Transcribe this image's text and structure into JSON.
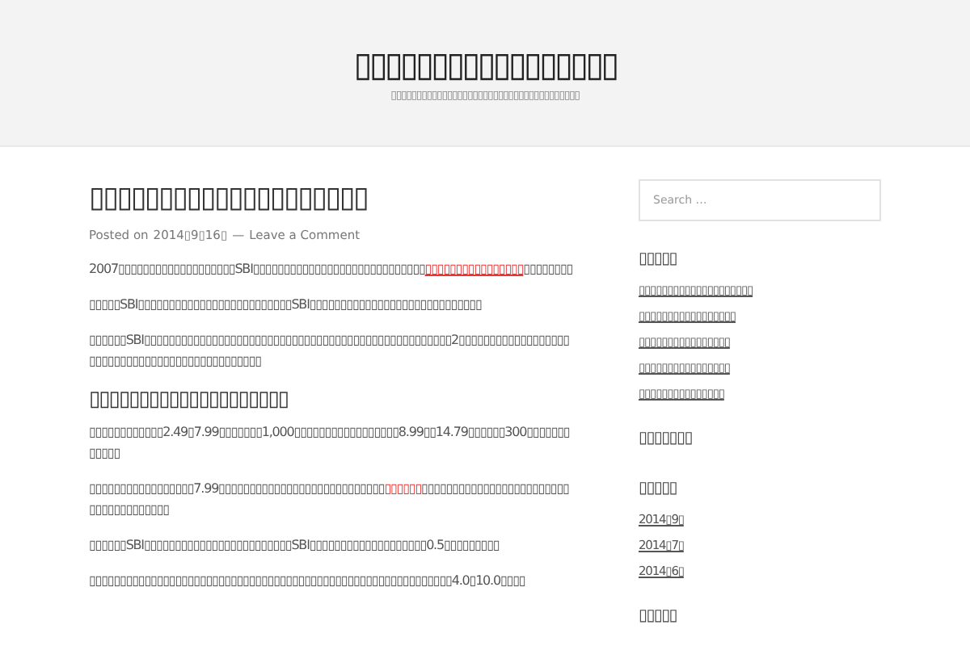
{
  "header": {
    "site_title": "▯▯▯▯▯▯▯▯▯▯▯▯▯▯▯▯▯",
    "tagline": "▯▯▯▯▯▯▯▯▯▯▯▯▯▯▯▯▯▯▯▯▯▯▯▯▯▯▯▯▯▯▯▯▯▯▯▯▯"
  },
  "post": {
    "title": "▯▯▯▯▯▯▯▯▯▯▯▯▯▯▯▯▯▯▯▯",
    "meta_prefix": "Posted on",
    "date": "2014▯9▯16▯",
    "meta_separator": "—",
    "comment_link": "Leave a Comment",
    "blocks": [
      {
        "kind": "paragraph",
        "segments": [
          {
            "kind": "text",
            "text": "2007▯▯▯▯▯▯▯▯▯▯▯▯▯▯▯▯▯▯▯SBI▯▯▯▯▯▯▯▯▯▯▯▯▯▯▯▯▯▯▯▯▯▯▯▯▯▯▯▯"
          },
          {
            "kind": "link",
            "text": "▯▯▯▯▯▯▯▯▯▯▯▯▯▯▯▯"
          },
          {
            "kind": "text",
            "text": "▯▯▯▯▯▯▯▯"
          }
        ]
      },
      {
        "kind": "paragraph",
        "segments": [
          {
            "kind": "text",
            "text": "▯▯▯▯▯SBI▯▯▯▯▯▯▯▯▯▯▯▯▯▯▯▯▯▯▯▯▯▯▯▯▯SBI▯▯▯▯▯▯▯▯▯▯▯▯▯▯▯▯▯▯▯▯▯▯▯▯▯▯▯▯"
          }
        ]
      },
      {
        "kind": "paragraph",
        "segments": [
          {
            "kind": "text",
            "text": "▯▯▯▯▯▯SBI▯▯▯▯▯▯▯▯▯▯▯▯▯▯▯▯▯▯▯▯▯▯▯▯▯▯▯▯▯▯▯▯▯▯▯▯▯▯▯▯▯▯▯▯▯▯▯▯▯▯2▯▯▯▯▯▯▯▯▯▯▯▯▯▯▯▯▯▯▯▯▯▯▯▯▯▯▯▯▯▯▯▯▯▯▯▯▯▯▯▯▯▯▯▯▯▯"
          }
        ]
      },
      {
        "kind": "heading",
        "text": "▯▯▯▯▯▯▯▯▯▯▯▯▯▯▯▯▯▯▯▯"
      },
      {
        "kind": "paragraph",
        "segments": [
          {
            "kind": "text",
            "text": "▯▯▯▯▯▯▯▯▯▯▯▯2.49▯7.99▯▯▯▯▯▯▯1,000▯▯▯▯▯▯▯▯▯▯▯▯▯▯▯▯▯8.99▯▯14.79▯▯▯▯▯▯300▯▯▯▯▯▯▯▯▯▯▯▯"
          }
        ]
      },
      {
        "kind": "paragraph",
        "segments": [
          {
            "kind": "text",
            "text": "▯▯▯▯▯▯▯▯▯▯▯▯▯▯▯▯▯7.99▯▯▯▯▯▯▯▯▯▯▯▯▯▯▯▯▯▯▯▯▯▯▯▯▯▯▯"
          },
          {
            "kind": "highlight",
            "text": "▯▯▯▯▯▯"
          },
          {
            "kind": "text",
            "text": "▯▯▯▯▯▯▯▯▯▯▯▯▯▯▯▯▯▯▯▯▯▯▯▯▯▯▯▯▯▯▯▯▯▯▯▯▯"
          }
        ]
      },
      {
        "kind": "paragraph",
        "segments": [
          {
            "kind": "text",
            "text": "▯▯▯▯▯▯SBI▯▯▯▯▯▯▯▯▯▯▯▯▯▯▯▯▯▯▯▯▯▯▯▯SBI▯▯▯▯▯▯▯▯▯▯▯▯▯▯▯▯▯▯▯0.5▯▯▯▯▯▯▯▯▯"
          }
        ]
      },
      {
        "kind": "paragraph",
        "segments": [
          {
            "kind": "text",
            "text": "▯▯▯▯▯▯▯▯▯▯▯▯▯▯▯▯▯▯▯▯▯▯▯▯▯▯▯▯▯▯▯▯▯▯▯▯▯▯▯▯▯▯▯▯▯▯▯▯▯▯▯▯▯▯▯▯▯▯▯4.0▯10.0▯▯▯▯"
          }
        ]
      }
    ]
  },
  "sidebar": {
    "search": {
      "placeholder": "Search …"
    },
    "widgets": [
      {
        "title": "▯▯▯▯▯",
        "links": [
          "▯▯▯▯▯▯▯▯▯▯▯▯▯▯▯▯▯▯▯▯",
          "▯▯▯▯▯▯▯▯▯▯▯▯▯▯▯▯▯",
          "▯▯▯▯▯▯▯▯▯▯▯▯▯▯▯▯",
          "▯▯▯▯▯▯▯▯▯▯▯▯▯▯▯▯",
          "▯▯▯▯▯▯▯▯▯▯▯▯▯▯▯"
        ]
      },
      {
        "title": "▯▯▯▯▯▯▯"
      },
      {
        "title": "▯▯▯▯▯",
        "links": [
          "2014▯9▯",
          "2014▯7▯",
          "2014▯6▯"
        ]
      },
      {
        "title": "▯▯▯▯▯"
      }
    ]
  }
}
